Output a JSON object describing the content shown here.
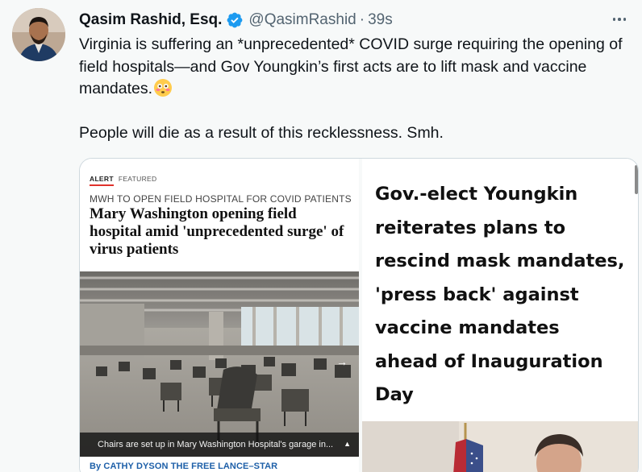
{
  "tweet": {
    "author_name": "Qasim Rashid, Esq.",
    "handle": "@QasimRashid",
    "separator": "·",
    "timestamp": "39s",
    "text_line1": "Virginia is suffering an *unprecedented* COVID surge requiring the opening of field hospitals—and Gov Youngkin’s first acts are to lift mask and vaccine mandates.",
    "text_line2": "People will die as a result of this recklessness. Smh.",
    "emoji": "flushed-face-icon",
    "verified_icon": "verified-badge-icon",
    "more_icon": "more-options-icon"
  },
  "media_left": {
    "tag_alert": "ALERT",
    "tag_featured": "FEATURED",
    "kicker": "MWH TO OPEN FIELD HOSPITAL FOR COVID PATIENTS",
    "headline": "Mary Washington opening field hospital amid 'unprecedented surge' of virus patients",
    "caption": "Chairs are set up in Mary Washington Hospital's garage in...",
    "caption_toggle": "▲",
    "next_arrow": "→",
    "byline": "By CATHY DYSON THE FREE LANCE–STAR"
  },
  "media_right": {
    "headline": "Gov.-elect Youngkin reiterates plans to rescind mask mandates, 'press back' against vaccine mandates ahead of Inauguration Day"
  },
  "colors": {
    "verified": "#1d9bf0",
    "text": "#0f1419",
    "secondary": "#536471",
    "alert_red": "#e0312b",
    "byline_blue": "#1d5fa8",
    "background": "#f7f9f9"
  }
}
